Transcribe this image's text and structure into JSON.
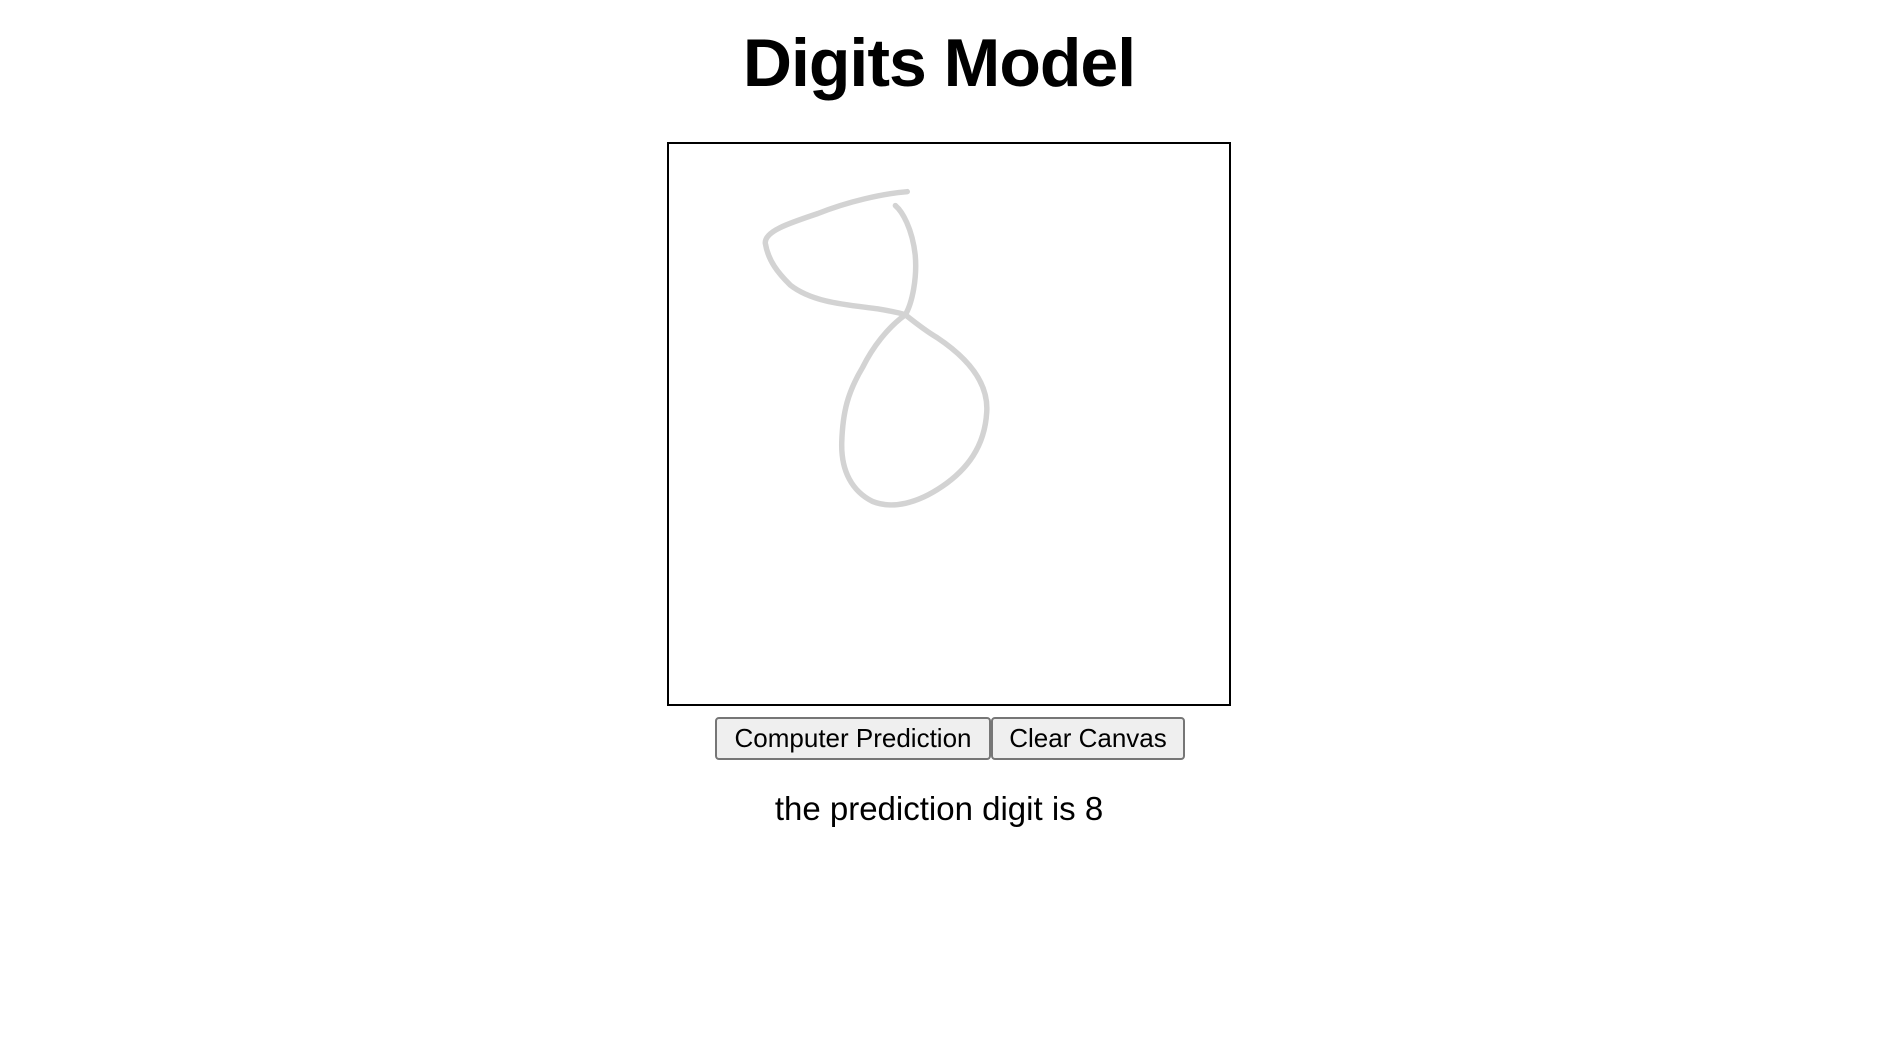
{
  "header": {
    "title": "Digits Model"
  },
  "canvas": {
    "stroke_color": "#d3d3d3",
    "drawn_digit_icon": "handwritten-eight"
  },
  "controls": {
    "predict_label": "Computer Prediction",
    "clear_label": "Clear Canvas"
  },
  "result": {
    "text": "the prediction digit is 8"
  }
}
